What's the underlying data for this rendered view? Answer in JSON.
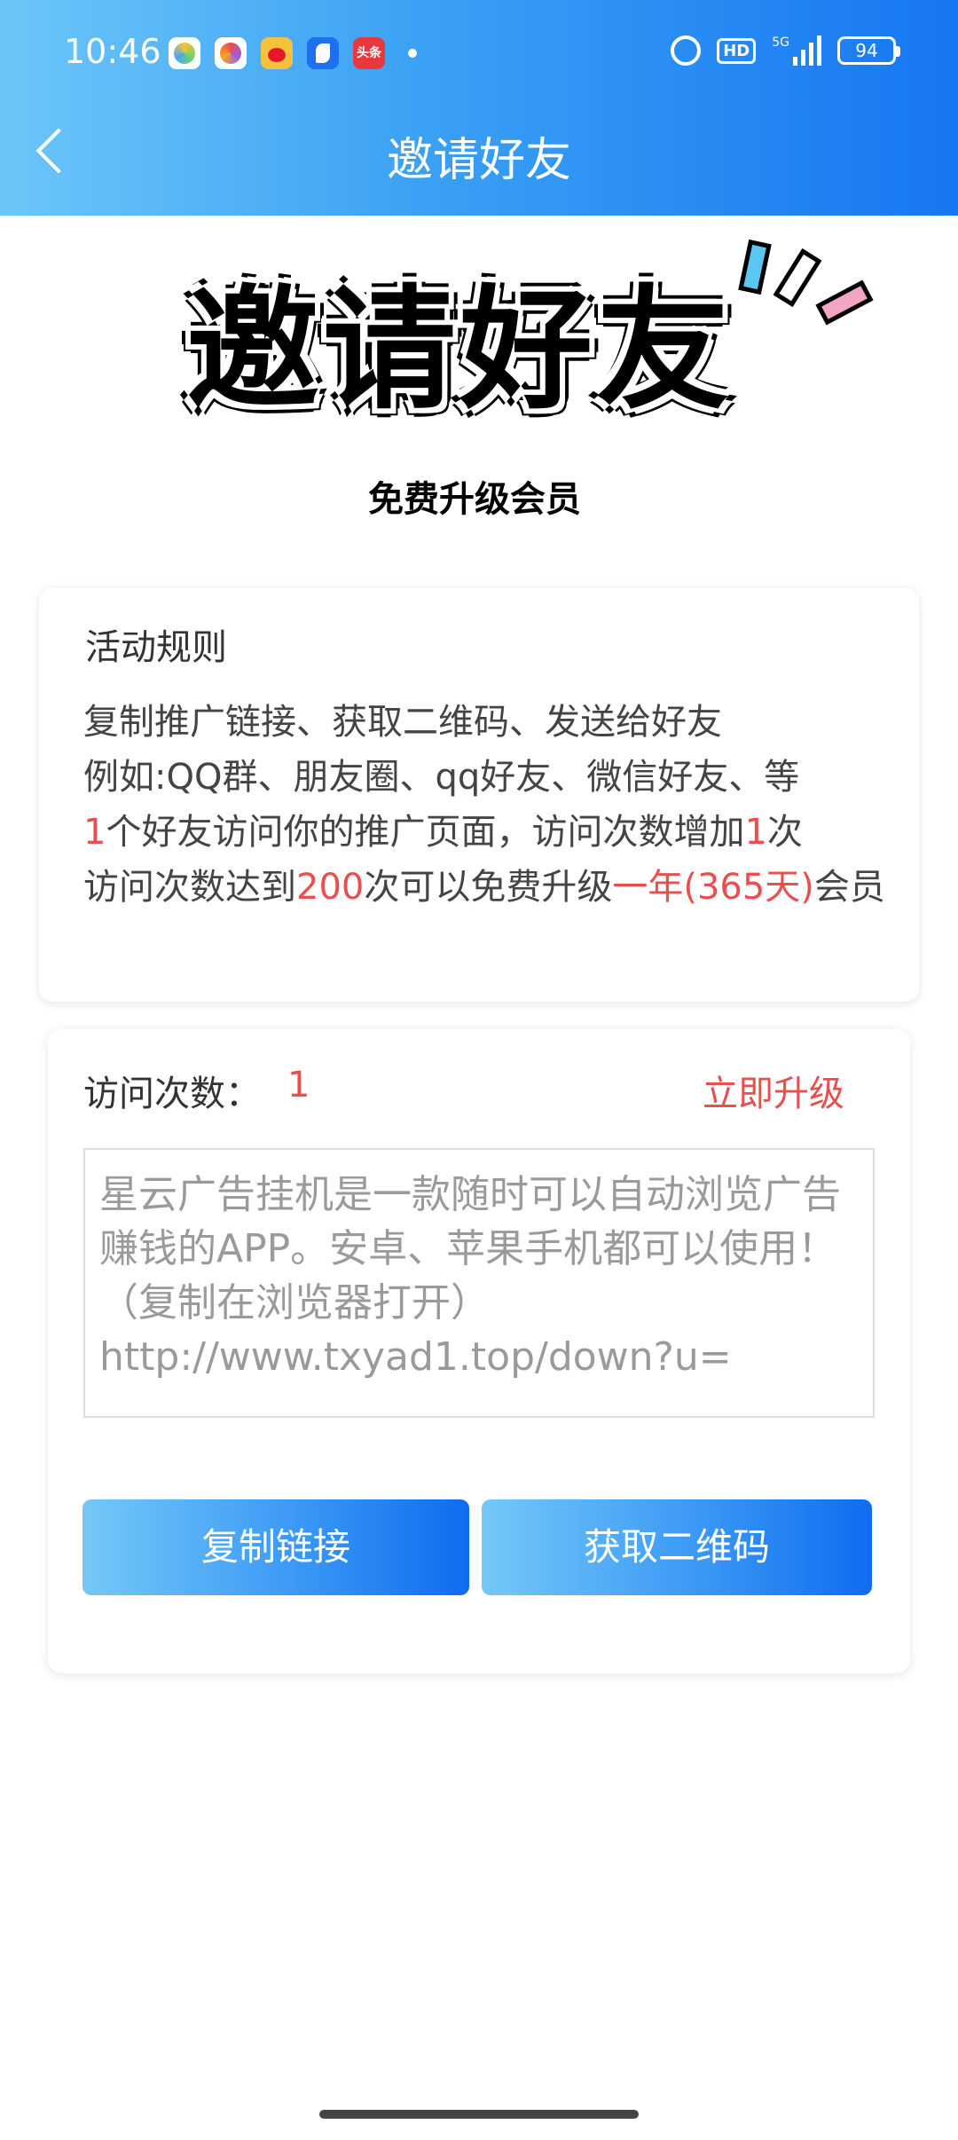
{
  "status_bar": {
    "time": "10:46",
    "notification_icons": [
      "wallet-app-icon",
      "palette-app-icon",
      "weibo-icon",
      "browser-app-icon",
      "toutiao-icon"
    ],
    "toutiao_text": "头条",
    "hd_label": "HD",
    "network": "5G",
    "battery": "94"
  },
  "header": {
    "title": "邀请好友"
  },
  "banner": {
    "title": "邀请好友",
    "subtitle": "免费升级会员"
  },
  "rules": {
    "title": "活动规则",
    "line1": "复制推广链接、获取二维码、发送给好友",
    "line2": "例如:QQ群、朋友圈、qq好友、微信好友、等",
    "line3_num1": "1",
    "line3_mid": "个好友访问你的推广页面，访问次数增加",
    "line3_num2": "1",
    "line3_end": "次",
    "line4_start": "访问次数达到",
    "line4_num": "200",
    "line4_mid": "次可以免费升级",
    "line4_highlight": "一年(365天)",
    "line4_end": "会员"
  },
  "invite": {
    "visit_label": "访问次数：",
    "visit_count": "1",
    "upgrade_label": "立即升级",
    "link_text": "星云广告挂机是一款随时可以自动浏览广告赚钱的APP。安卓、苹果手机都可以使用！（复制在浏览器打开）http://www.txyad1.top/down?u=",
    "copy_button": "复制链接",
    "qrcode_button": "获取二维码"
  },
  "colors": {
    "accent_red": "#e94f4f",
    "header_start": "#6cc6f8",
    "header_end": "#1677f2"
  }
}
